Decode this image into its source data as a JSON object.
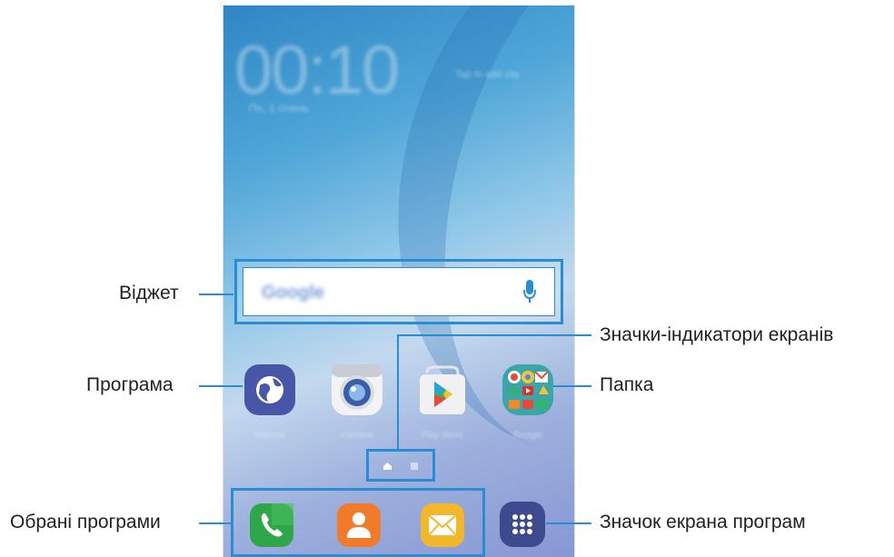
{
  "callouts": {
    "widget": "Віджет",
    "app": "Програма",
    "favorites": "Обрані програми",
    "indicators": "Значки-індикатори екранів",
    "folder": "Папка",
    "apps_button": "Значок екрана програм"
  },
  "colors": {
    "accent": "#2a8dd3",
    "text": "#231f20"
  }
}
